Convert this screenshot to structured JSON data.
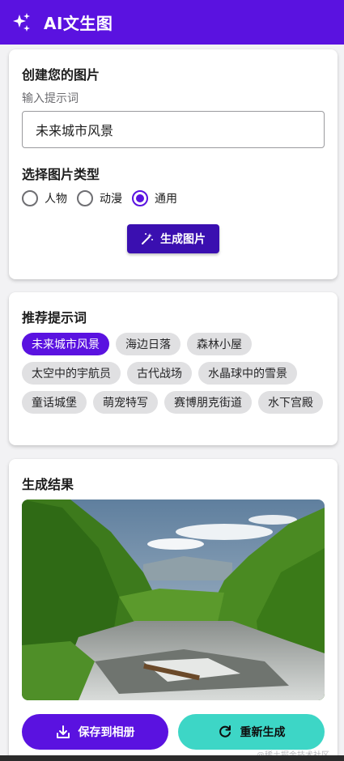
{
  "app": {
    "title": "AI文生图"
  },
  "create": {
    "title": "创建您的图片",
    "prompt_label": "输入提示词",
    "prompt_value": "未来城市风景",
    "type_title": "选择图片类型",
    "types": [
      {
        "label": "人物",
        "checked": false
      },
      {
        "label": "动漫",
        "checked": false
      },
      {
        "label": "通用",
        "checked": true
      }
    ],
    "generate_label": "生成图片"
  },
  "suggest": {
    "title": "推荐提示词",
    "chips": [
      "未来城市风景",
      "海边日落",
      "森林小屋",
      "太空中的宇航员",
      "古代战场",
      "水晶球中的雪景",
      "童话城堡",
      "萌宠特写",
      "赛博朋克街道",
      "水下宫殿"
    ],
    "active_index": 0
  },
  "result": {
    "title": "生成结果",
    "save_label": "保存到相册",
    "regen_label": "重新生成"
  },
  "colors": {
    "primary": "#5a12e0",
    "primary_dark": "#3a0fb0",
    "accent_teal": "#3dd6c6"
  },
  "watermark": "@稀土掘金技术社区"
}
